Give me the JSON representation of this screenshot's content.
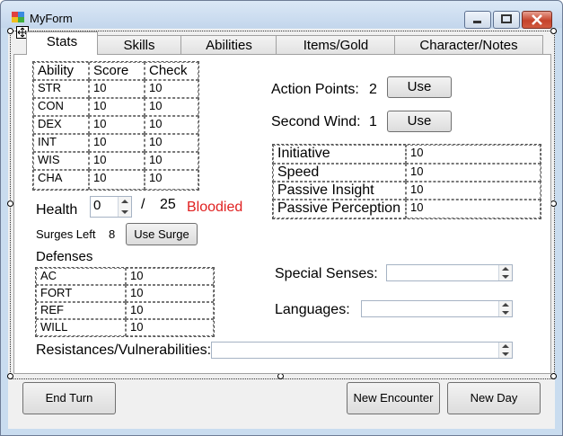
{
  "window": {
    "title": "MyForm"
  },
  "tabs": [
    "Stats",
    "Skills",
    "Abilities",
    "Items/Gold",
    "Character/Notes"
  ],
  "abilities": {
    "headers": [
      "Ability",
      "Score",
      "Check"
    ],
    "rows": [
      [
        "STR",
        "10",
        "10"
      ],
      [
        "CON",
        "10",
        "10"
      ],
      [
        "DEX",
        "10",
        "10"
      ],
      [
        "INT",
        "10",
        "10"
      ],
      [
        "WIS",
        "10",
        "10"
      ],
      [
        "CHA",
        "10",
        "10"
      ]
    ]
  },
  "health": {
    "label": "Health",
    "current": "0",
    "separator": "/",
    "max": "25",
    "status": "Bloodied",
    "status_color": "#e02020"
  },
  "surges": {
    "label": "Surges Left",
    "value": "8",
    "button": "Use Surge"
  },
  "defenses": {
    "label": "Defenses",
    "rows": [
      [
        "AC",
        "10"
      ],
      [
        "FORT",
        "10"
      ],
      [
        "REF",
        "10"
      ],
      [
        "WILL",
        "10"
      ]
    ]
  },
  "action_points": {
    "label": "Action Points:",
    "value": "2",
    "button": "Use"
  },
  "second_wind": {
    "label": "Second Wind:",
    "value": "1",
    "button": "Use"
  },
  "stats": {
    "rows": [
      [
        "Initiative",
        "10"
      ],
      [
        "Speed",
        "10"
      ],
      [
        "Passive Insight",
        "10"
      ],
      [
        "Passive Perception",
        "10"
      ]
    ]
  },
  "special_senses": {
    "label": "Special Senses:",
    "value": ""
  },
  "languages": {
    "label": "Languages:",
    "value": ""
  },
  "resistances": {
    "label": "Resistances/Vulnerabilities:",
    "value": ""
  },
  "footer": {
    "end_turn": "End Turn",
    "new_encounter": "New Encounter",
    "new_day": "New Day"
  },
  "icons": [
    "form-icon",
    "minimize-icon",
    "maximize-icon",
    "close-icon",
    "move-icon",
    "spin-up-icon",
    "spin-down-icon"
  ]
}
